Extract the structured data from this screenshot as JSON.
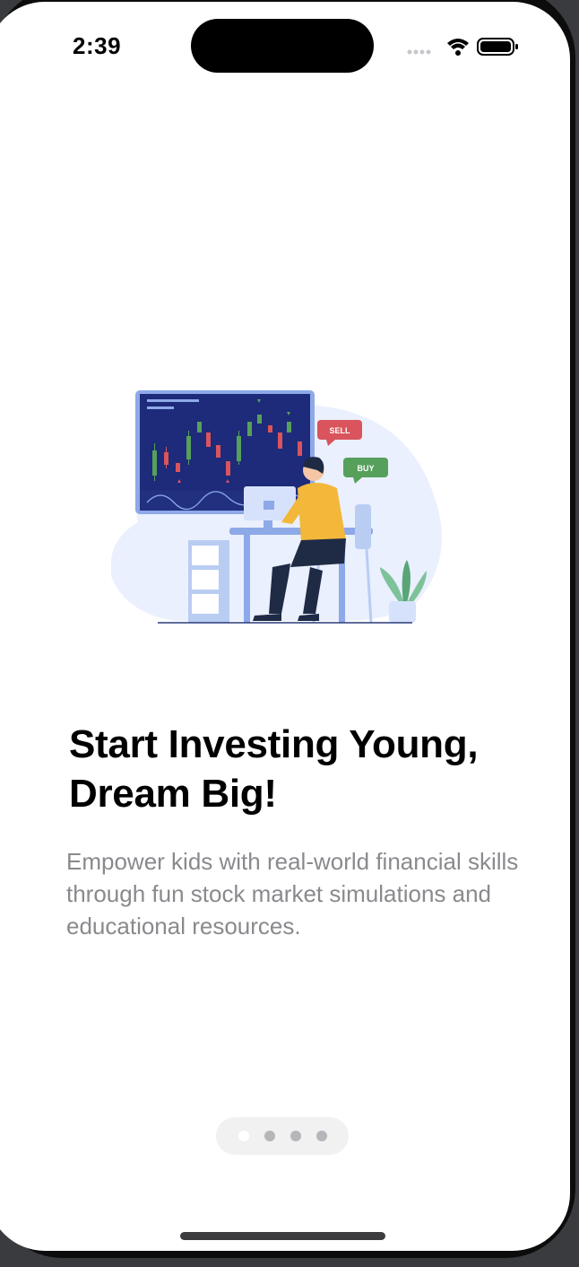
{
  "status_bar": {
    "time": "2:39",
    "icons": [
      "signal-icon",
      "wifi-icon",
      "battery-icon"
    ]
  },
  "illustration": {
    "sell_label": "SELL",
    "buy_label": "BUY",
    "colors": {
      "monitor": "#1e2a7a",
      "monitor_frame": "#8ea9e8",
      "blob": "#eaf0fd",
      "sell": "#d9545c",
      "buy": "#57a05c",
      "shirt": "#f3b73a",
      "pants": "#1f2b45"
    }
  },
  "onboarding": {
    "title": "Start Investing Young, Dream Big!",
    "description": "Empower kids with real-world financial skills through fun stock market simulations and educational resources."
  },
  "pager": {
    "page_count": 4,
    "active_index": 0
  }
}
